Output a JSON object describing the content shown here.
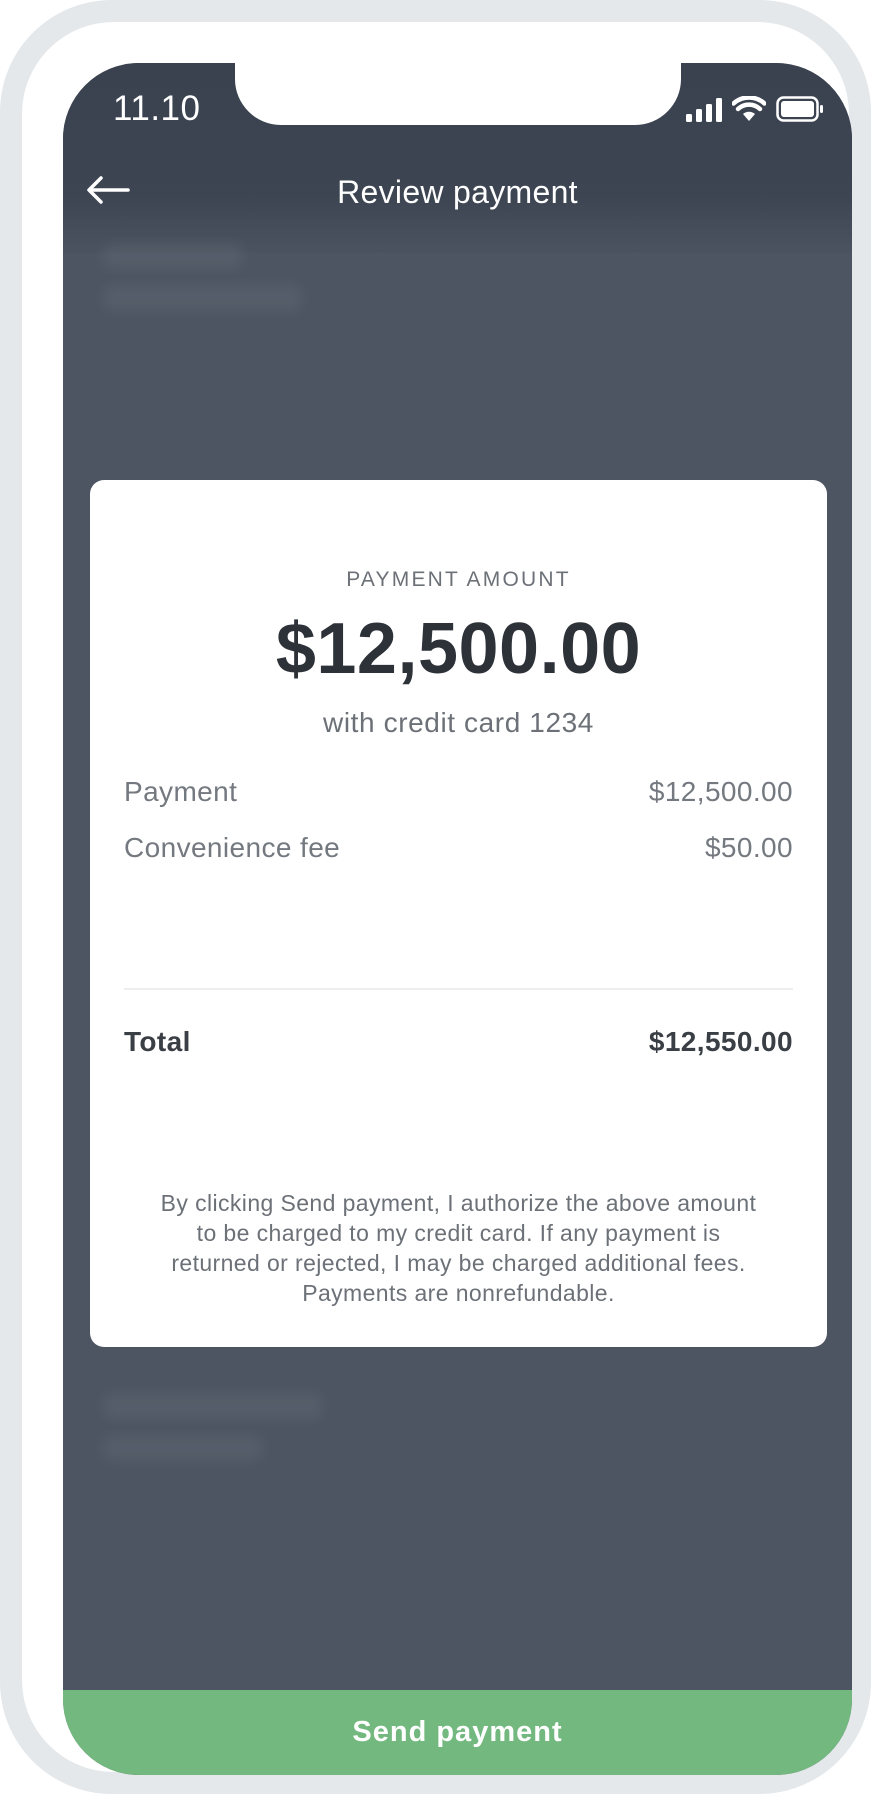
{
  "status_bar": {
    "time": "11.10",
    "icons": [
      "signal-icon",
      "wifi-icon",
      "battery-icon"
    ]
  },
  "header": {
    "back_icon": "arrow-left-icon",
    "title": "Review payment"
  },
  "card": {
    "amount_label": "PAYMENT AMOUNT",
    "amount_value": "$12,500.00",
    "amount_sub": "with credit card 1234",
    "line_items": [
      {
        "label": "Payment",
        "value": "$12,500.00"
      },
      {
        "label": "Convenience fee",
        "value": "$50.00"
      }
    ],
    "total": {
      "label": "Total",
      "value": "$12,550.00"
    },
    "disclaimer": "By clicking Send payment, I authorize the above amount to be charged to my credit card. If any payment is returned or rejected, I may be charged additional fees. Payments are nonrefundable."
  },
  "footer": {
    "send_label": "Send payment"
  },
  "colors": {
    "header_bg": "#3a4250",
    "overlay_bg": "#4d5562",
    "card_bg": "#ffffff",
    "primary_text": "#2d3138",
    "secondary_text": "#6c7178",
    "accent_green": "#73b87e"
  }
}
